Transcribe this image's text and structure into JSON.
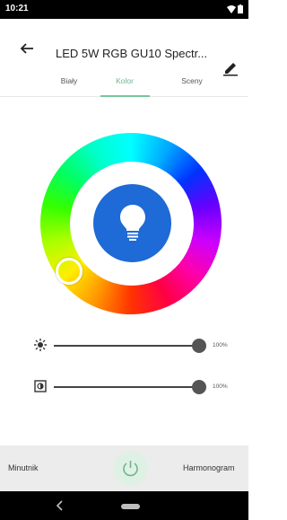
{
  "status_bar": {
    "time": "10:21"
  },
  "app_bar": {
    "title": "LED 5W RGB GU10 Spectr..."
  },
  "tabs": [
    {
      "label": "Biały",
      "active": false
    },
    {
      "label": "Kolor",
      "active": true
    },
    {
      "label": "Sceny",
      "active": false
    }
  ],
  "colors": {
    "accent": "#79c59b",
    "bulb_button": "#1e6ad6",
    "power_button_bg": "#dff0e5"
  },
  "sliders": [
    {
      "icon": "brightness-icon",
      "value": "100%",
      "level": 1.0
    },
    {
      "icon": "color-temperature-icon",
      "value": "100%",
      "level": 1.0
    }
  ],
  "bottom_bar": {
    "left_label": "Minutnik",
    "right_label": "Harmonogram"
  }
}
